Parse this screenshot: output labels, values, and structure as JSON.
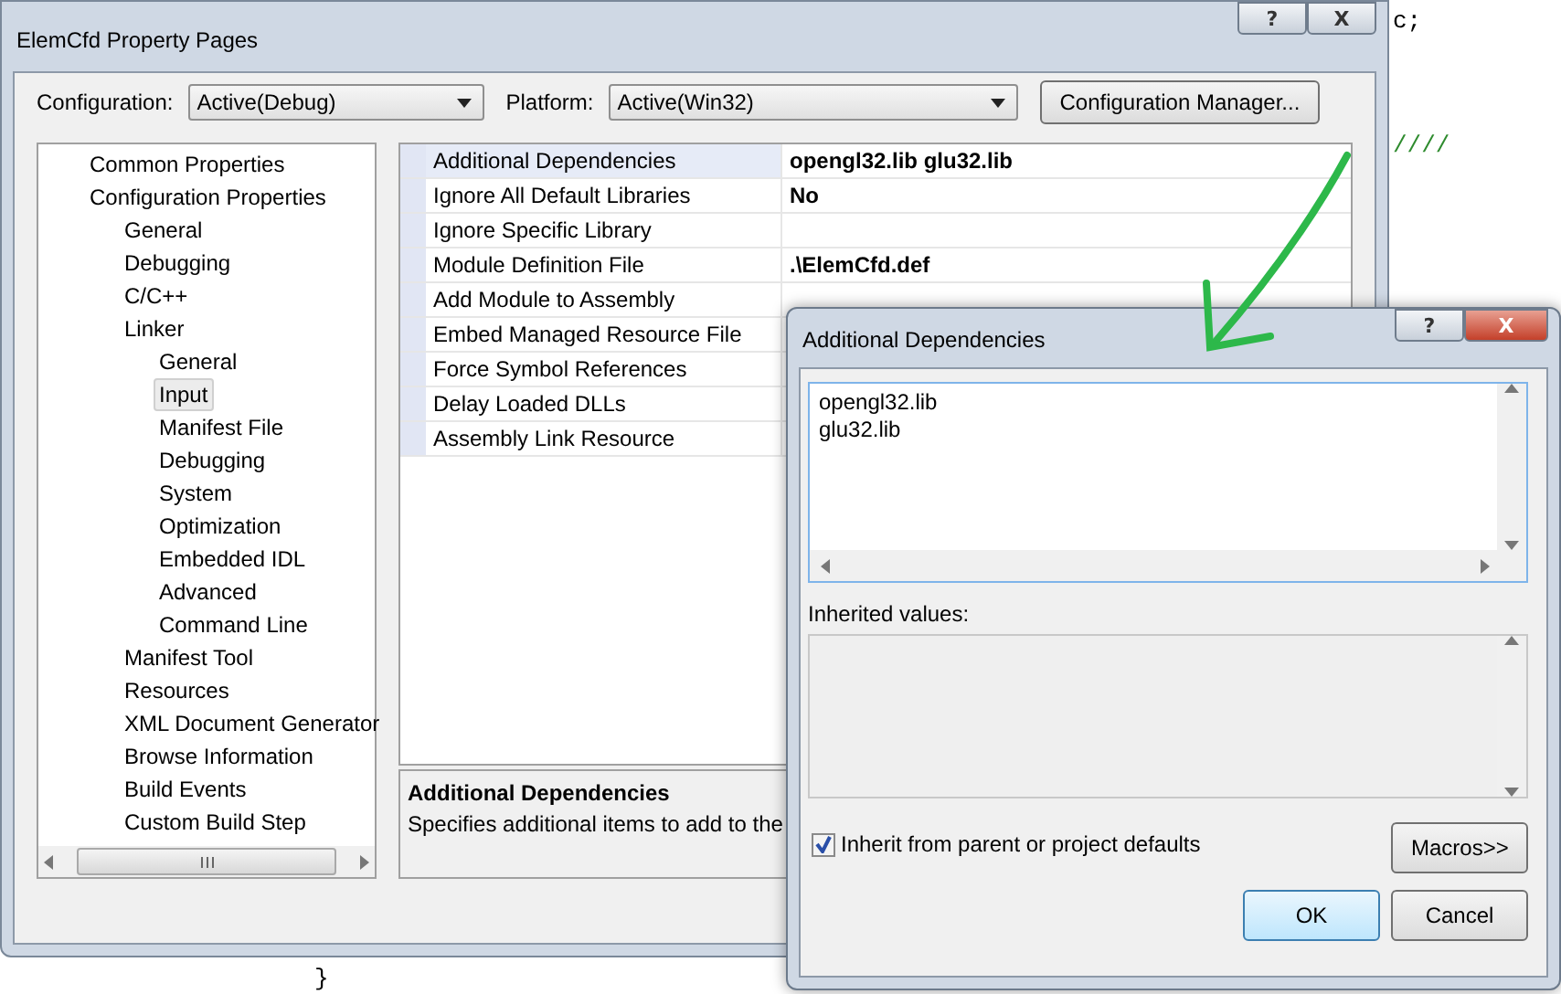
{
  "editor": {
    "code_fragments": [
      "c;",
      "////",
      "}"
    ]
  },
  "window": {
    "title": "ElemCfd Property Pages"
  },
  "toolbar": {
    "configuration_label": "Configuration:",
    "configuration_value": "Active(Debug)",
    "platform_label": "Platform:",
    "platform_value": "Active(Win32)",
    "manager_button": "Configuration Manager..."
  },
  "tree": [
    {
      "label": "Common Properties",
      "selected": false
    },
    {
      "label": "Configuration Properties",
      "selected": false,
      "children": [
        {
          "label": "General",
          "selected": false
        },
        {
          "label": "Debugging",
          "selected": false
        },
        {
          "label": "C/C++",
          "selected": false
        },
        {
          "label": "Linker",
          "selected": false,
          "children": [
            {
              "label": "General",
              "selected": false
            },
            {
              "label": "Input",
              "selected": true
            },
            {
              "label": "Manifest File",
              "selected": false
            },
            {
              "label": "Debugging",
              "selected": false
            },
            {
              "label": "System",
              "selected": false
            },
            {
              "label": "Optimization",
              "selected": false
            },
            {
              "label": "Embedded IDL",
              "selected": false
            },
            {
              "label": "Advanced",
              "selected": false
            },
            {
              "label": "Command Line",
              "selected": false
            }
          ]
        },
        {
          "label": "Manifest Tool",
          "selected": false
        },
        {
          "label": "Resources",
          "selected": false
        },
        {
          "label": "XML Document Generator",
          "selected": false
        },
        {
          "label": "Browse Information",
          "selected": false
        },
        {
          "label": "Build Events",
          "selected": false
        },
        {
          "label": "Custom Build Step",
          "selected": false
        }
      ]
    }
  ],
  "properties": [
    {
      "name": "Additional Dependencies",
      "value": "opengl32.lib glu32.lib",
      "selected": true
    },
    {
      "name": "Ignore All Default Libraries",
      "value": "No",
      "selected": false
    },
    {
      "name": "Ignore Specific Library",
      "selected": false
    },
    {
      "name": "Module Definition File",
      "value": ".\\ElemCfd.def",
      "selected": false
    },
    {
      "name": "Add Module to Assembly",
      "selected": false
    },
    {
      "name": "Embed Managed Resource File",
      "selected": false
    },
    {
      "name": "Force Symbol References",
      "selected": false
    },
    {
      "name": "Delay Loaded DLLs",
      "selected": false
    },
    {
      "name": "Assembly Link Resource",
      "selected": false
    }
  ],
  "description": {
    "title": "Additional Dependencies",
    "text": "Specifies additional items to add to the"
  },
  "dialog": {
    "title": "Additional Dependencies",
    "help_button": "?",
    "close_button": "X",
    "lines": [
      "opengl32.lib",
      "glu32.lib"
    ],
    "inherited_label": "Inherited values:",
    "inherit_checkbox": {
      "label": "Inherit from parent or project defaults",
      "checked": true
    },
    "macros_button": "Macros>>",
    "ok_button": "OK",
    "cancel_button": "Cancel"
  },
  "window_buttons": {
    "help_button": "?",
    "close_button": "X"
  }
}
